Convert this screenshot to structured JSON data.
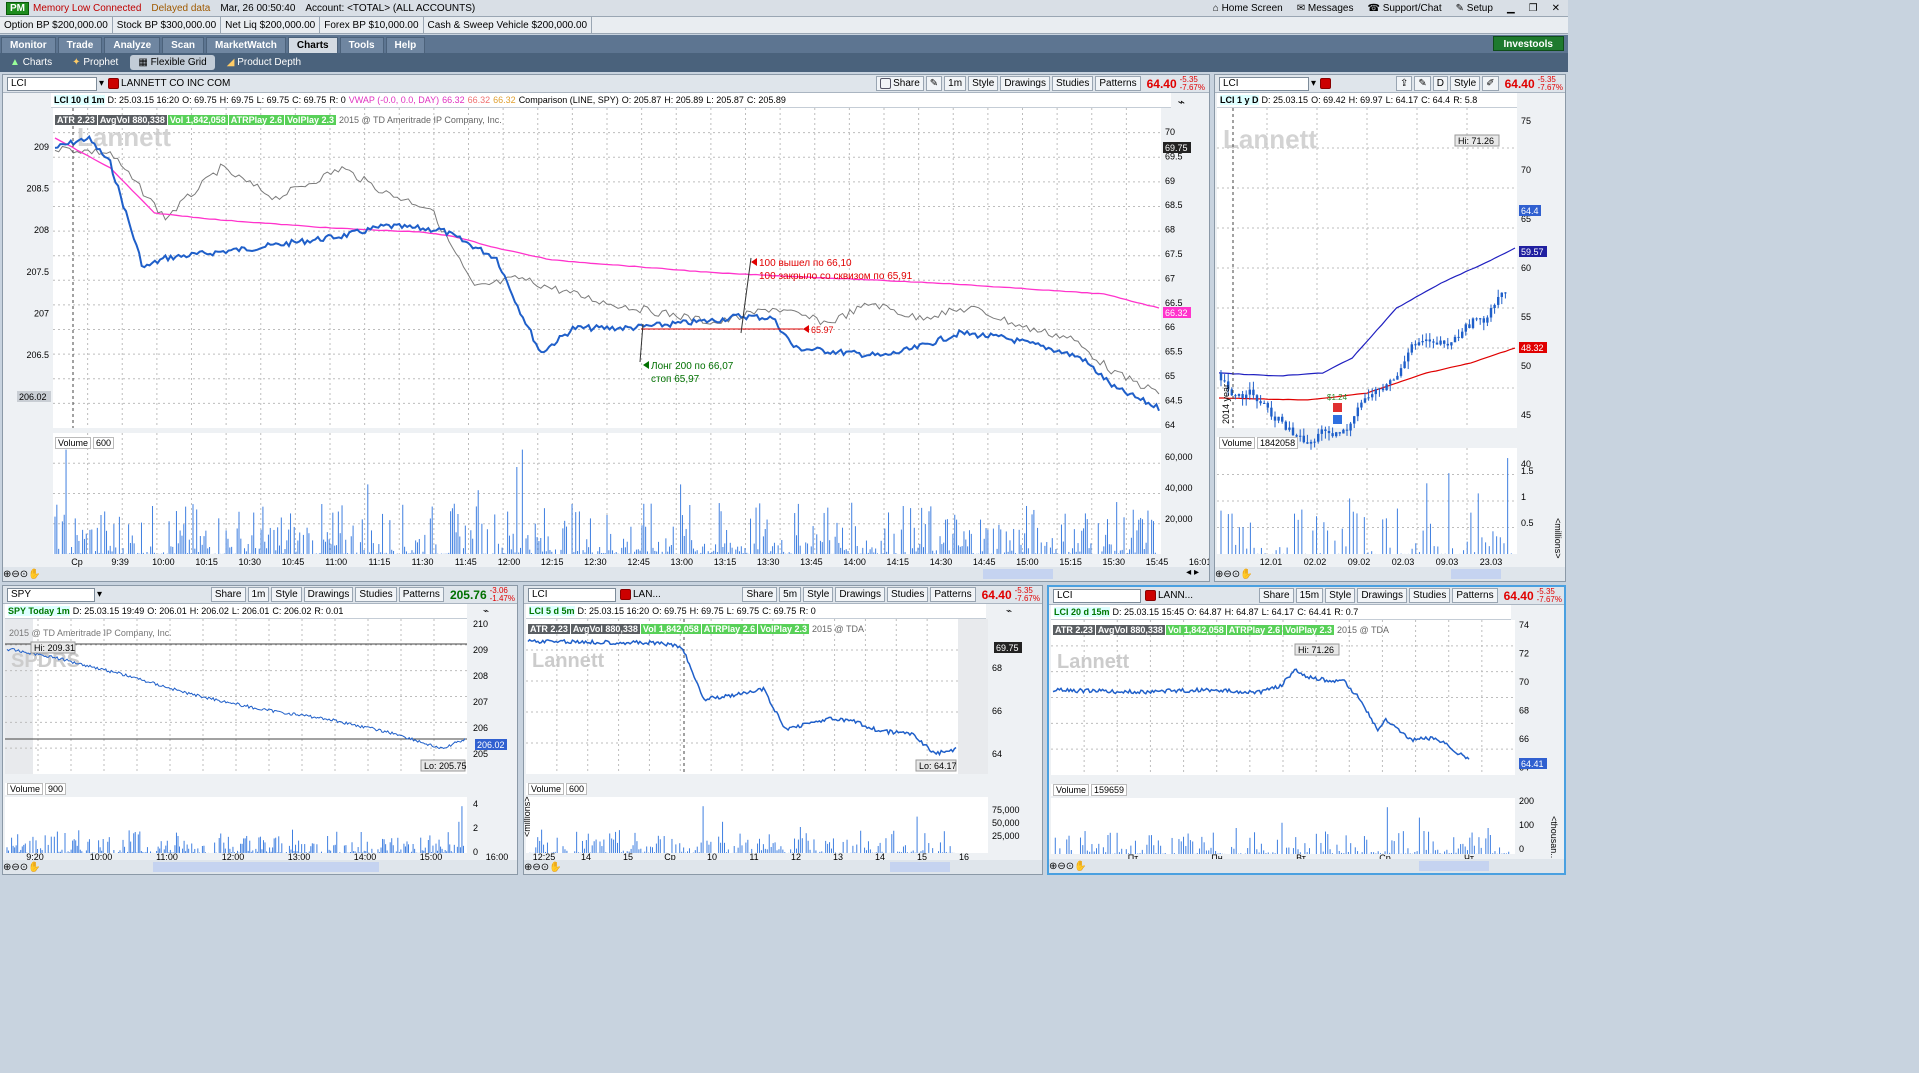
{
  "topbar": {
    "pm": "PM",
    "memory": "Memory Low Connected",
    "delayed": "Delayed data",
    "datetime": "Mar, 26  00:50:40",
    "account": "Account: <TOTAL> (ALL ACCOUNTS)",
    "home": "Home Screen",
    "messages": "Messages",
    "support": "Support/Chat",
    "setup": "Setup"
  },
  "accbar": [
    "Option BP  $200,000.00",
    "Stock BP  $300,000.00",
    "Net Liq  $200,000.00",
    "Forex BP  $10,000.00",
    "Cash & Sweep Vehicle  $200,000.00"
  ],
  "nav": {
    "tabs": [
      "Monitor",
      "Trade",
      "Analyze",
      "Scan",
      "MarketWatch",
      "Charts",
      "Tools",
      "Help"
    ],
    "active": "Charts",
    "investools": "Investools"
  },
  "subnav": [
    "Charts",
    "Prophet",
    "Flexible Grid",
    "Product Depth"
  ],
  "buttons": {
    "share": "Share",
    "style": "Style",
    "drawings": "Drawings",
    "studies": "Studies",
    "patterns": "Patterns"
  },
  "main": {
    "symbol": "LCI",
    "company": "LANNETT CO INC COM",
    "interval": "1m",
    "price": "64.40",
    "chg1": "-5.35",
    "chg2": "-7.67%",
    "info": [
      "LCI 10 d 1m",
      "D: 25.03.15 16:20",
      "O: 69.75",
      "H: 69.75",
      "L: 69.75",
      "C: 69.75",
      "R: 0",
      "VWAP (-0.0, 0.0, DAY)",
      "66.32",
      "66.32",
      "66.32",
      "Comparison (LINE, SPY)",
      "O: 205.87",
      "H: 205.89",
      "L: 205.87",
      "C: 205.89"
    ],
    "studies": [
      "ATR 2.23",
      "AvgVol 880,338",
      "Vol 1,842,058",
      "ATRPlay 2.6",
      "VolPlay 2.3"
    ],
    "copyright": "2015 @ TD Ameritrade IP Company, Inc.",
    "logo": "Lannett",
    "left_ticks": [
      "209",
      "208.5",
      "208",
      "207.5",
      "207",
      "206.5"
    ],
    "left_tag": "206.02",
    "right_ticks": [
      "70",
      "69.5",
      "69",
      "68.5",
      "68",
      "67.5",
      "67",
      "66.5",
      "66",
      "65.5",
      "65",
      "64.5",
      "64"
    ],
    "tag_top": "69.75",
    "tag_vwap": "66.32",
    "ann_exit1": "100 вышел по 66,10",
    "ann_exit2": "100 закрыло со сквизом по 65,91",
    "ann_stop": "65.97",
    "ann_long1": "Лонг 200 по 66,07",
    "ann_long2": "стоп 65,97",
    "vol_label": "Volume",
    "vol_val": "600",
    "vol_ticks": [
      "60,000",
      "40,000",
      "20,000"
    ],
    "time_ticks": [
      "Cp",
      "9:39",
      "10:00",
      "10:15",
      "10:30",
      "10:45",
      "11:00",
      "11:15",
      "11:30",
      "11:45",
      "12:00",
      "12:15",
      "12:30",
      "12:45",
      "13:00",
      "13:15",
      "13:30",
      "13:45",
      "14:00",
      "14:15",
      "14:30",
      "14:45",
      "15:00",
      "15:15",
      "15:30",
      "15:45",
      "16:01"
    ]
  },
  "daily": {
    "symbol": "LCI",
    "interval": "D",
    "price": "64.40",
    "chg1": "-5.35",
    "chg2": "-7.67%",
    "info": [
      "LCI 1 y D",
      "D: 25.03.15",
      "O: 69.42",
      "H: 69.97",
      "L: 64.17",
      "C: 64.4",
      "R: 5.8"
    ],
    "ticks": [
      "75",
      "70",
      "65",
      "60",
      "55",
      "50",
      "45",
      "40"
    ],
    "hi": "Hi: 71.26",
    "tag1": "64.4",
    "tag2": "59.57",
    "tag3": "48.32",
    "earn": "$1.24",
    "year": "2014 year",
    "vol_val": "1842058",
    "vol_ticks": [
      "1.5",
      "1",
      "0.5"
    ],
    "vol_unit": "<millions>",
    "time_ticks": [
      "12.01",
      "02.02",
      "09.02",
      "02.03",
      "09.03",
      "23.03"
    ]
  },
  "spy": {
    "symbol": "SPY",
    "interval": "1m",
    "price": "205.76",
    "chg1": "-3.06",
    "chg2": "-1.47%",
    "info": [
      "SPY Today 1m",
      "D: 25.03.15 19:49",
      "O: 206.01",
      "H: 206.02",
      "L: 206.01",
      "C: 206.02",
      "R: 0.01"
    ],
    "copyright": "2015 @ TD Ameritrade IP Company, Inc.",
    "logo": "SPDRS",
    "hi": "Hi: 209.31",
    "lo": "Lo: 205.75",
    "tag": "206.02",
    "ticks": [
      "210",
      "209",
      "208",
      "207",
      "206",
      "205"
    ],
    "vol_val": "900",
    "vol_ticks": [
      "4",
      "2",
      "0"
    ],
    "time_ticks": [
      "9:20",
      "10:00",
      "11:00",
      "12:00",
      "13:00",
      "14:00",
      "15:00",
      "16:00"
    ]
  },
  "lci5": {
    "symbol": "LCI",
    "name": "LAN...",
    "interval": "5m",
    "price": "64.40",
    "chg1": "-5.35",
    "chg2": "-7.67%",
    "info": [
      "LCI 5 d 5m",
      "D: 25.03.15 16:20",
      "O: 69.75",
      "H: 69.75",
      "L: 69.75",
      "C: 69.75",
      "R: 0"
    ],
    "studies": [
      "ATR 2.23",
      "AvgVol 880,338",
      "Vol 1,842,058",
      "ATRPlay 2.6",
      "VolPlay 2.3"
    ],
    "copyright": "2015 @ TDA",
    "logo": "Lannett",
    "lo": "Lo: 64.17",
    "tag": "69.75",
    "ticks": [
      "68",
      "66",
      "64"
    ],
    "vol_val": "600",
    "vol_ticks": [
      "75,000",
      "50,000",
      "25,000"
    ],
    "vol_unit": "<millions>",
    "time_ticks": [
      "12:25",
      "14",
      "15",
      "Cp",
      "10",
      "11",
      "12",
      "13",
      "14",
      "15",
      "16"
    ]
  },
  "lci20": {
    "symbol": "LCI",
    "name": "LANN...",
    "interval": "15m",
    "price": "64.40",
    "chg1": "-5.35",
    "chg2": "-7.67%",
    "info": [
      "LCI 20 d 15m",
      "D: 25.03.15 15:45",
      "O: 64.87",
      "H: 64.87",
      "L: 64.17",
      "C: 64.41",
      "R: 0.7"
    ],
    "studies": [
      "ATR 2.23",
      "AvgVol 880,338",
      "Vol 1,842,058",
      "ATRPlay 2.6",
      "VolPlay 2.3"
    ],
    "copyright": "2015 @ TDA",
    "logo": "Lannett",
    "hi": "Hi: 71.26",
    "tag": "64.41",
    "ticks": [
      "74",
      "72",
      "70",
      "68",
      "66",
      "64"
    ],
    "vol_val": "159659",
    "vol_ticks": [
      "200",
      "100",
      "0"
    ],
    "vol_unit": "<thousan...",
    "time_ticks": [
      "Пт",
      "Пн",
      "Вт",
      "Ср",
      "Чт"
    ]
  },
  "colors": {
    "price_line": "#1f5fc9",
    "vwap": "#ff33cc",
    "comparison": "#777777",
    "red": "#e00000",
    "green": "#007000",
    "volume": "#3f7fe0"
  }
}
